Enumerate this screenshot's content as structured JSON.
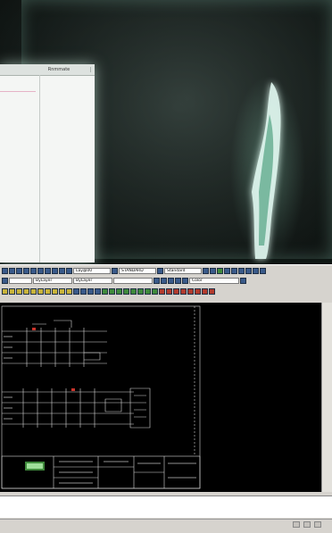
{
  "paper": {
    "columns": [
      "",
      "Rnmmate"
    ]
  },
  "cad": {
    "toolbar1": {
      "layer_combo": "Lay@00",
      "standard_combo": "STANDARD",
      "style_combo": "Standard"
    },
    "toolbar2": {
      "linetype_combo": "ByLayer",
      "lineweight_combo": "ByLayer",
      "plotstyle_combo": "Color"
    },
    "command_lines": [
      "",
      "",
      ""
    ]
  },
  "colors": {
    "accent": "#3f8a3c",
    "drawing_bg": "#000000",
    "linework": "#d8d8d8",
    "highlight": "#c9342b"
  },
  "icons": [
    "new-icon",
    "open-icon",
    "save-icon",
    "print-icon",
    "layer-icon",
    "zoom-icon",
    "pan-icon",
    "properties-icon"
  ]
}
